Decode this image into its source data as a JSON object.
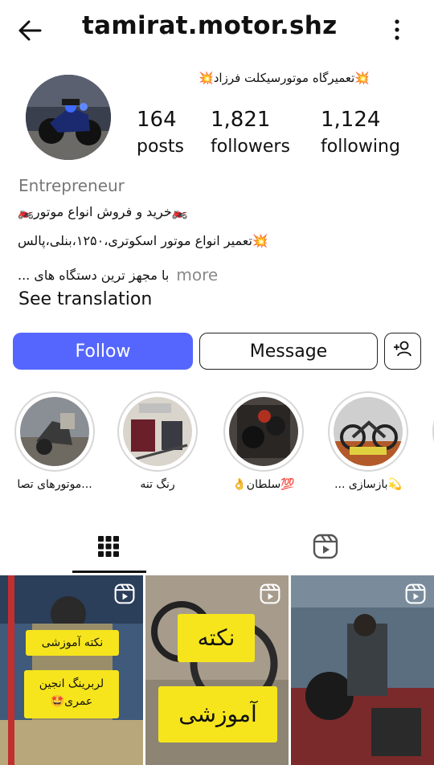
{
  "topbar": {
    "username": "tamirat.motor.shz",
    "back_icon": "back-arrow-icon",
    "menu_icon": "more-vertical-icon"
  },
  "profile": {
    "full_name": "💥تعمیرگاه موتورسیکلت فرزاد💥",
    "stats": [
      {
        "value": "164",
        "label": "posts"
      },
      {
        "value": "1,821",
        "label": "followers"
      },
      {
        "value": "1,124",
        "label": "following"
      }
    ],
    "category": "Entrepreneur",
    "bio_lines": [
      "🏍️خرید و فروش انواع موتور🏍️",
      "💥تعمیر انواع موتور اسکوتری،۱۲۵۰،بنلی،پالس",
      "با مجهز ترین دستگاه های ..."
    ],
    "more_label": "more",
    "translate_label": "See translation"
  },
  "actions": {
    "follow": "Follow",
    "message": "Message",
    "add_user_icon": "add-user-icon"
  },
  "highlights": [
    {
      "caption": "...موتورهای تصا"
    },
    {
      "caption": "رنگ تنه"
    },
    {
      "caption": "💯سلطان👌"
    },
    {
      "caption": "💫بازسازی ..."
    }
  ],
  "tabs": [
    {
      "name": "posts-grid",
      "icon": "grid-icon",
      "active": true
    },
    {
      "name": "reels",
      "icon": "reels-icon",
      "active": false
    }
  ],
  "posts": [
    {
      "overlay": [
        "نکته آموزشی",
        "لربرینگ انجین عمری🤩"
      ]
    },
    {
      "overlay": [
        "نکته",
        "آموزشی"
      ]
    },
    {
      "overlay": []
    }
  ],
  "colors": {
    "follow_button": "#5566ff",
    "caption_box": "#f6e51c"
  }
}
